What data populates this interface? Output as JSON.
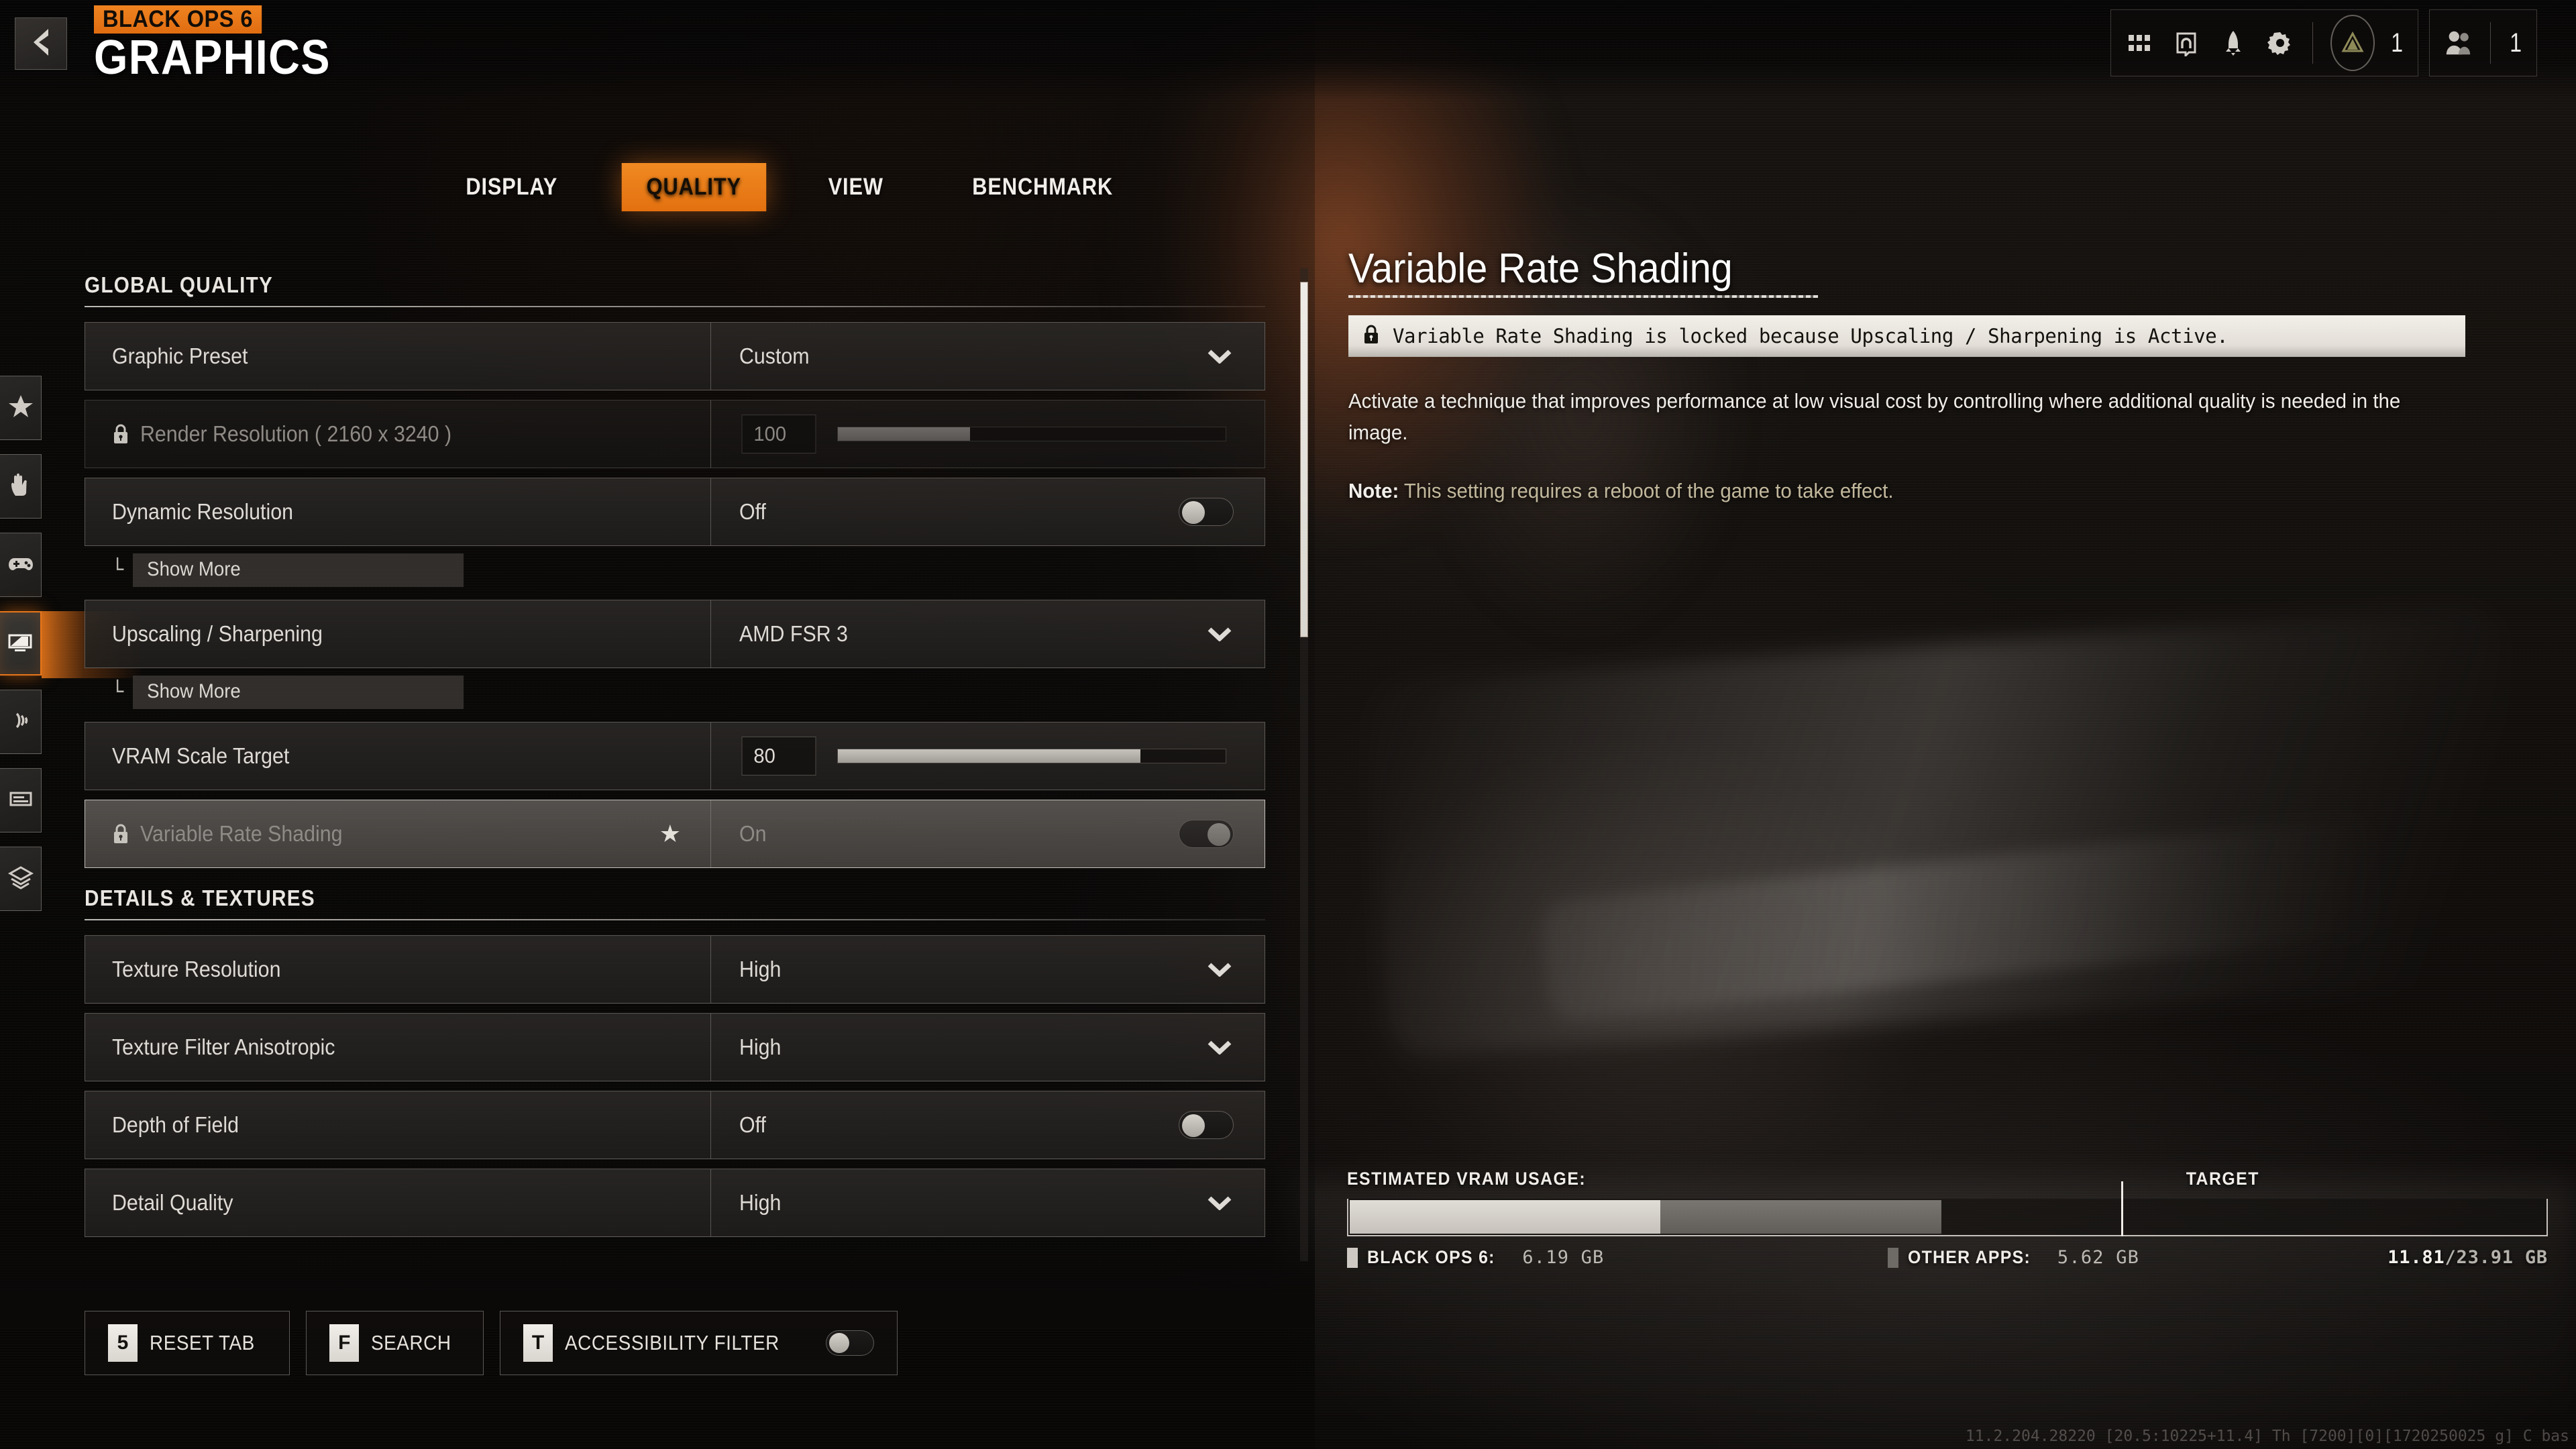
{
  "header": {
    "back_label": "Back",
    "logo_top": "BLACK OPS 6",
    "logo_bottom": "GRAPHICS"
  },
  "topbar": {
    "icons": [
      "grid-icon",
      "headset-icon",
      "rocket-icon",
      "gear-icon"
    ],
    "rank_icon": "rank-chevron-icon",
    "rank_value": "1",
    "social_icon": "social-players-icon",
    "social_value": "1"
  },
  "tabs": [
    {
      "label": "DISPLAY",
      "active": false
    },
    {
      "label": "QUALITY",
      "active": true
    },
    {
      "label": "VIEW",
      "active": false
    },
    {
      "label": "BENCHMARK",
      "active": false
    }
  ],
  "left_rail": [
    {
      "name": "general",
      "icon": "star-icon",
      "active": false
    },
    {
      "name": "gesture",
      "icon": "hand-icon",
      "active": false
    },
    {
      "name": "controller",
      "icon": "gamepad-icon",
      "active": false
    },
    {
      "name": "graphics",
      "icon": "monitor-icon",
      "active": true
    },
    {
      "name": "audio",
      "icon": "sound-wave-icon",
      "active": false
    },
    {
      "name": "interface",
      "icon": "hud-panel-icon",
      "active": false
    },
    {
      "name": "account",
      "icon": "layers-icon",
      "active": false
    }
  ],
  "sections": [
    {
      "title": "GLOBAL QUALITY",
      "rows": [
        {
          "label": "Graphic Preset",
          "value": "Custom",
          "control": "dropdown",
          "locked": false,
          "selected": false,
          "starred": false
        },
        {
          "label": "Render Resolution ( 2160 x 3240 )",
          "value": "100",
          "control": "slider",
          "slider_percent": 34,
          "locked": true,
          "selected": false,
          "starred": false
        },
        {
          "label": "Dynamic Resolution",
          "value": "Off",
          "control": "toggle",
          "toggle_state": "off",
          "locked": false,
          "selected": false,
          "starred": false,
          "sub_item": "Show More"
        },
        {
          "label": "Upscaling / Sharpening",
          "value": "AMD FSR 3",
          "control": "dropdown",
          "locked": false,
          "selected": false,
          "starred": false,
          "sub_item": "Show More"
        },
        {
          "label": "VRAM Scale Target",
          "value": "80",
          "control": "slider",
          "slider_percent": 78,
          "locked": false,
          "selected": false,
          "starred": false
        },
        {
          "label": "Variable Rate Shading",
          "value": "On",
          "control": "toggle",
          "toggle_state": "on",
          "locked": true,
          "selected": true,
          "starred": true
        }
      ]
    },
    {
      "title": "DETAILS & TEXTURES",
      "rows": [
        {
          "label": "Texture Resolution",
          "value": "High",
          "control": "dropdown",
          "locked": false,
          "selected": false,
          "starred": false
        },
        {
          "label": "Texture Filter Anisotropic",
          "value": "High",
          "control": "dropdown",
          "locked": false,
          "selected": false,
          "starred": false
        },
        {
          "label": "Depth of Field",
          "value": "Off",
          "control": "toggle",
          "toggle_state": "off",
          "locked": false,
          "selected": false,
          "starred": false
        },
        {
          "label": "Detail Quality",
          "value": "High",
          "control": "dropdown",
          "locked": false,
          "selected": false,
          "starred": false
        }
      ]
    }
  ],
  "detail": {
    "title": "Variable Rate Shading",
    "lock_icon": "lock-icon",
    "lock_message": "Variable Rate Shading is locked because Upscaling / Sharpening is Active.",
    "body": "Activate a technique that improves performance at low visual cost by controlling where additional quality is needed in the image.",
    "note_label": "Note:",
    "note_text": "This setting requires a reboot of the game to take effect."
  },
  "vram": {
    "label": "ESTIMATED VRAM USAGE:",
    "target_label": "TARGET",
    "game_legend": "BLACK OPS 6:",
    "game_value": "6.19 GB",
    "other_legend": "OTHER APPS:",
    "other_value": "5.62 GB",
    "total_used": "11.81",
    "total_sep": "/",
    "total_cap": "23.91 GB",
    "game_percent": 25.9,
    "other_percent": 23.5,
    "target_percent": 64.5
  },
  "bottom_buttons": [
    {
      "key": "5",
      "label": "RESET TAB",
      "toggle": false
    },
    {
      "key": "F",
      "label": "SEARCH",
      "toggle": false
    },
    {
      "key": "T",
      "label": "ACCESSIBILITY FILTER",
      "toggle": true,
      "toggle_state": "off"
    }
  ],
  "build_string": "11.2.204.28220 [20.5:10225+11.4] Th [7200][0][1720250025 g] C bas",
  "colors": {
    "accent": "#e8761a",
    "panel": "#232120",
    "text": "#dedad5",
    "note": "#c2b89c"
  }
}
